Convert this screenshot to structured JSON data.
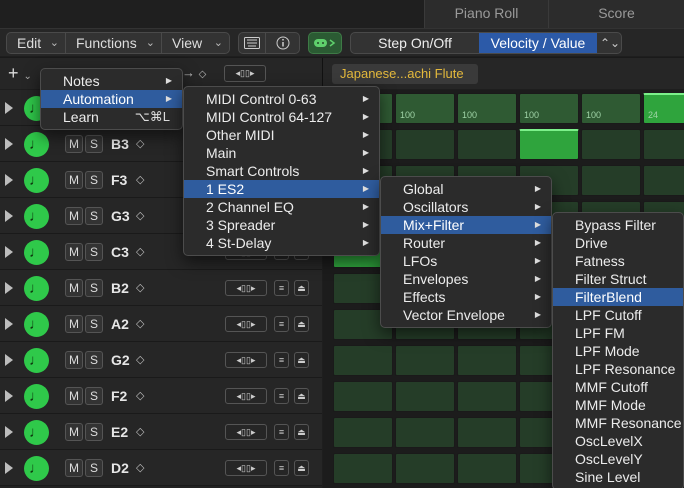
{
  "tabs": {
    "piano_roll": "Piano Roll",
    "score": "Score"
  },
  "toolbar": {
    "edit": "Edit",
    "functions": "Functions",
    "view": "View",
    "step_on_off": "Step On/Off",
    "velocity_value": "Velocity / Value"
  },
  "pattern_name": "Japanese...achi Flute",
  "tracks": [
    {
      "pitch": ""
    },
    {
      "pitch": "B3"
    },
    {
      "pitch": "F3"
    },
    {
      "pitch": "G3"
    },
    {
      "pitch": "C3"
    },
    {
      "pitch": "B2"
    },
    {
      "pitch": "A2"
    },
    {
      "pitch": "G2"
    },
    {
      "pitch": "F2"
    },
    {
      "pitch": "E2"
    },
    {
      "pitch": "D2"
    }
  ],
  "grid_values": [
    "100",
    "100",
    "100",
    "100",
    "100",
    "24"
  ],
  "menu1": {
    "items": [
      {
        "label": "Notes"
      },
      {
        "label": "Automation"
      },
      {
        "label": "Learn",
        "shortcut": "⌥⌘L"
      }
    ]
  },
  "menu2": {
    "items": [
      {
        "label": "MIDI Control 0-63"
      },
      {
        "label": "MIDI Control 64-127"
      },
      {
        "label": "Other MIDI"
      },
      {
        "label": "Main"
      },
      {
        "label": "Smart Controls"
      },
      {
        "label": "1 ES2"
      },
      {
        "label": "2 Channel EQ"
      },
      {
        "label": "3 Spreader"
      },
      {
        "label": "4 St-Delay"
      }
    ]
  },
  "menu3": {
    "items": [
      {
        "label": "Global"
      },
      {
        "label": "Oscillators"
      },
      {
        "label": "Mix+Filter"
      },
      {
        "label": "Router"
      },
      {
        "label": "LFOs"
      },
      {
        "label": "Envelopes"
      },
      {
        "label": "Effects"
      },
      {
        "label": "Vector Envelope"
      }
    ]
  },
  "menu4": {
    "items": [
      {
        "label": "Bypass Filter"
      },
      {
        "label": "Drive"
      },
      {
        "label": "Fatness"
      },
      {
        "label": "Filter Struct"
      },
      {
        "label": "FilterBlend"
      },
      {
        "label": "LPF Cutoff"
      },
      {
        "label": "LPF FM"
      },
      {
        "label": "LPF Mode"
      },
      {
        "label": "LPF Resonance"
      },
      {
        "label": "MMF Cutoff"
      },
      {
        "label": "MMF Mode"
      },
      {
        "label": "MMF Resonance"
      },
      {
        "label": "OscLevelX"
      },
      {
        "label": "OscLevelY"
      },
      {
        "label": "Sine Level"
      }
    ]
  },
  "colors": {
    "accent": "#2f5c9e",
    "note_green": "#2fc94a",
    "pattern_name": "#e4b93c"
  }
}
